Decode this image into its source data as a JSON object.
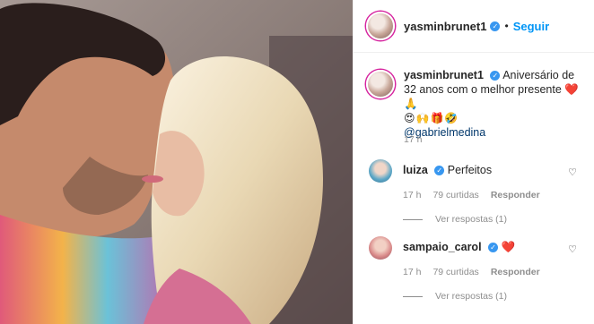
{
  "header": {
    "username": "yasminbrunet1",
    "separator": "•",
    "follow_label": "Seguir"
  },
  "caption": {
    "username": "yasminbrunet1",
    "text": "Aniversário de 32 anos com o melhor presente",
    "emoji_inline": "❤️🙏",
    "emoji_row": "😍🙌🎁🤣",
    "mention": "@gabrielmedina",
    "time": "17 h"
  },
  "comments": [
    {
      "username": "luiza",
      "text": "Perfeitos",
      "time": "17 h",
      "likes": "79 curtidas",
      "reply_label": "Responder",
      "view_replies": "Ver respostas (1)"
    },
    {
      "username": "sampaio_carol",
      "text": "❤️",
      "time": "17 h",
      "likes": "79 curtidas",
      "reply_label": "Responder",
      "view_replies": "Ver respostas (1)"
    }
  ],
  "icons": {
    "verified": "verified-badge-icon",
    "like": "heart-outline-icon"
  },
  "colors": {
    "follow": "#0095f6",
    "verified": "#3897f0",
    "heart": "#ed1c24",
    "muted": "#8e8e8e"
  }
}
